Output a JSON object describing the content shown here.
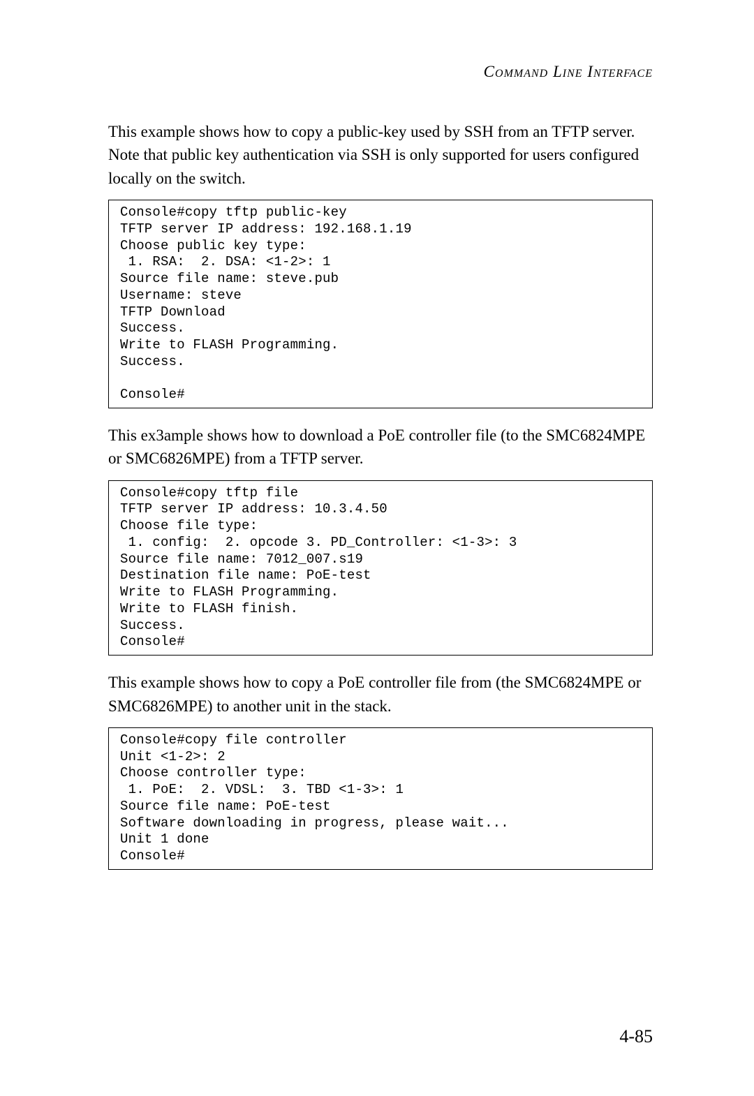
{
  "header": "Command Line Interface",
  "para1": "This example shows how to copy a public-key used by SSH from an TFTP server. Note that public key authentication via SSH is only supported for users configured locally on the switch.",
  "code1": "Console#copy tftp public-key\nTFTP server IP address: 192.168.1.19\nChoose public key type:\n 1. RSA:  2. DSA: <1-2>: 1\nSource file name: steve.pub\nUsername: steve\nTFTP Download\nSuccess.\nWrite to FLASH Programming.\nSuccess.\n\nConsole#",
  "para2": "This ex3ample shows how to download a PoE controller file (to the SMC6824MPE or SMC6826MPE) from a TFTP server.",
  "code2": "Console#copy tftp file\nTFTP server IP address: 10.3.4.50\nChoose file type:\n 1. config:  2. opcode 3. PD_Controller: <1-3>: 3\nSource file name: 7012_007.s19\nDestination file name: PoE-test\nWrite to FLASH Programming.\nWrite to FLASH finish.\nSuccess.\nConsole#",
  "para3": "This example shows how to copy a PoE controller file from (the SMC6824MPE or SMC6826MPE) to another unit in the stack.",
  "code3": "Console#copy file controller\nUnit <1-2>: 2\nChoose controller type:\n 1. PoE:  2. VDSL:  3. TBD <1-3>: 1\nSource file name: PoE-test\nSoftware downloading in progress, please wait...\nUnit 1 done\nConsole#",
  "page_number": "4-85"
}
